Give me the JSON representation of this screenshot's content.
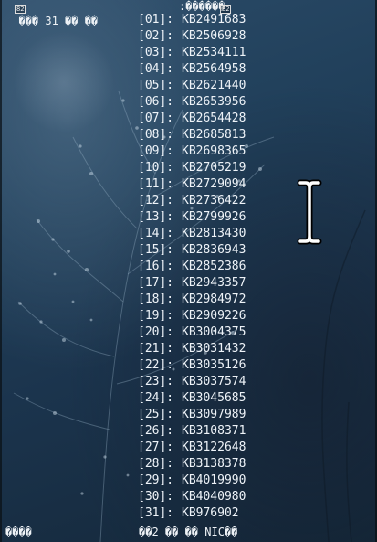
{
  "header": {
    "left_text": "��� 31 �� ��",
    "right_text": ":������",
    "box_left": "82",
    "box_right": "82"
  },
  "items": [
    {
      "index": "[01]:",
      "kb": "KB2491683"
    },
    {
      "index": "[02]:",
      "kb": "KB2506928"
    },
    {
      "index": "[03]:",
      "kb": "KB2534111"
    },
    {
      "index": "[04]:",
      "kb": "KB2564958"
    },
    {
      "index": "[05]:",
      "kb": "KB2621440"
    },
    {
      "index": "[06]:",
      "kb": "KB2653956"
    },
    {
      "index": "[07]:",
      "kb": "KB2654428"
    },
    {
      "index": "[08]:",
      "kb": "KB2685813"
    },
    {
      "index": "[09]:",
      "kb": "KB2698365"
    },
    {
      "index": "[10]:",
      "kb": "KB2705219"
    },
    {
      "index": "[11]:",
      "kb": "KB2729094"
    },
    {
      "index": "[12]:",
      "kb": "KB2736422"
    },
    {
      "index": "[13]:",
      "kb": "KB2799926"
    },
    {
      "index": "[14]:",
      "kb": "KB2813430"
    },
    {
      "index": "[15]:",
      "kb": "KB2836943"
    },
    {
      "index": "[16]:",
      "kb": "KB2852386"
    },
    {
      "index": "[17]:",
      "kb": "KB2943357"
    },
    {
      "index": "[18]:",
      "kb": "KB2984972"
    },
    {
      "index": "[19]:",
      "kb": "KB2909226"
    },
    {
      "index": "[20]:",
      "kb": "KB3004375"
    },
    {
      "index": "[21]:",
      "kb": "KB3031432"
    },
    {
      "index": "[22]:",
      "kb": "KB3035126"
    },
    {
      "index": "[23]:",
      "kb": "KB3037574"
    },
    {
      "index": "[24]:",
      "kb": "KB3045685"
    },
    {
      "index": "[25]:",
      "kb": "KB3097989"
    },
    {
      "index": "[26]:",
      "kb": "KB3108371"
    },
    {
      "index": "[27]:",
      "kb": "KB3122648"
    },
    {
      "index": "[28]:",
      "kb": "KB3138378"
    },
    {
      "index": "[29]:",
      "kb": "KB4019990"
    },
    {
      "index": "[30]:",
      "kb": "KB4040980"
    },
    {
      "index": "[31]:",
      "kb": "KB976902"
    }
  ],
  "footer": {
    "left_text": "����",
    "mid_text": "��2 �� �� NIC��"
  },
  "icons": {
    "cursor": "i-beam-cursor-icon"
  }
}
